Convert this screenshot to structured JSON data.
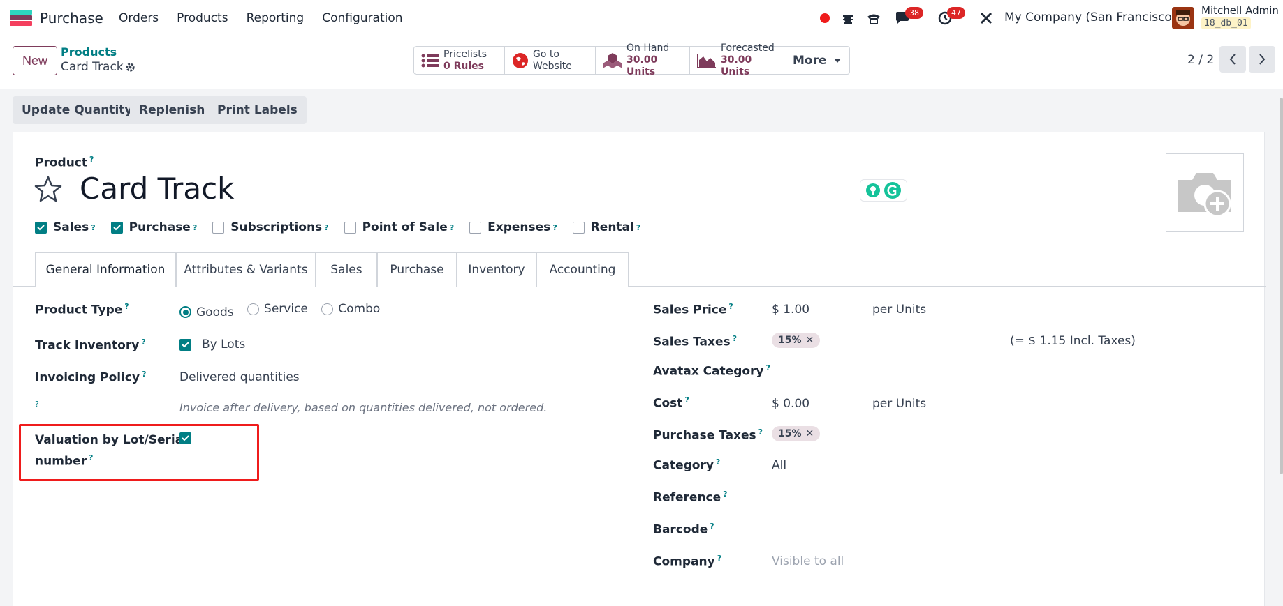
{
  "navbar": {
    "app_name": "Purchase",
    "menu": [
      "Orders",
      "Products",
      "Reporting",
      "Configuration"
    ],
    "chat_badge": "38",
    "activity_badge": "47",
    "company": "My Company (San Francisco)",
    "user_name": "Mitchell Admin",
    "db_name": "18_db_01"
  },
  "control_panel": {
    "new_label": "New",
    "breadcrumb_parent": "Products",
    "breadcrumb_current": "Card Track",
    "smart_buttons": [
      {
        "label": "Pricelists",
        "value": "0 Rules",
        "icon": "list-icon"
      },
      {
        "label": "Go to",
        "value": "Website",
        "icon": "globe-icon"
      },
      {
        "label": "On Hand",
        "value": "30.00 Units",
        "icon": "cubes-icon"
      },
      {
        "label": "Forecasted",
        "value": "30.00 Units",
        "icon": "area-chart-icon"
      }
    ],
    "more_label": "More",
    "pager": "2 / 2"
  },
  "actions": [
    "Update Quantity",
    "Replenish",
    "Print Labels"
  ],
  "form": {
    "product_label": "Product",
    "help_mark": "?",
    "product_name": "Card Track",
    "flags": [
      {
        "label": "Sales",
        "checked": true
      },
      {
        "label": "Purchase",
        "checked": true
      },
      {
        "label": "Subscriptions",
        "checked": false
      },
      {
        "label": "Point of Sale",
        "checked": false
      },
      {
        "label": "Expenses",
        "checked": false
      },
      {
        "label": "Rental",
        "checked": false
      }
    ],
    "tabs": [
      "General Information",
      "Attributes & Variants",
      "Sales",
      "Purchase",
      "Inventory",
      "Accounting"
    ],
    "left": {
      "product_type_label": "Product Type",
      "product_type_options": [
        "Goods",
        "Service",
        "Combo"
      ],
      "product_type_selected": "Goods",
      "track_inventory_label": "Track Inventory",
      "track_inventory_value": "By Lots",
      "invoicing_policy_label": "Invoicing Policy",
      "invoicing_policy_value": "Delivered quantities",
      "invoicing_help": "Invoice after delivery, based on quantities delivered, not ordered.",
      "valuation_label_1": "Valuation by Lot/Serial",
      "valuation_label_2": "number"
    },
    "right": {
      "sales_price_label": "Sales Price",
      "sales_price_value": "$ 1.00",
      "sales_price_uom": "per Units",
      "sales_taxes_label": "Sales Taxes",
      "sales_tax_tag": "15%",
      "sales_tax_incl": "(= $ 1.15 Incl. Taxes)",
      "avatax_label": "Avatax Category",
      "cost_label": "Cost",
      "cost_value": "$ 0.00",
      "cost_uom": "per Units",
      "purchase_taxes_label": "Purchase Taxes",
      "purchase_tax_tag": "15%",
      "category_label": "Category",
      "category_value": "All",
      "reference_label": "Reference",
      "barcode_label": "Barcode",
      "company_label": "Company",
      "company_placeholder": "Visible to all"
    }
  }
}
